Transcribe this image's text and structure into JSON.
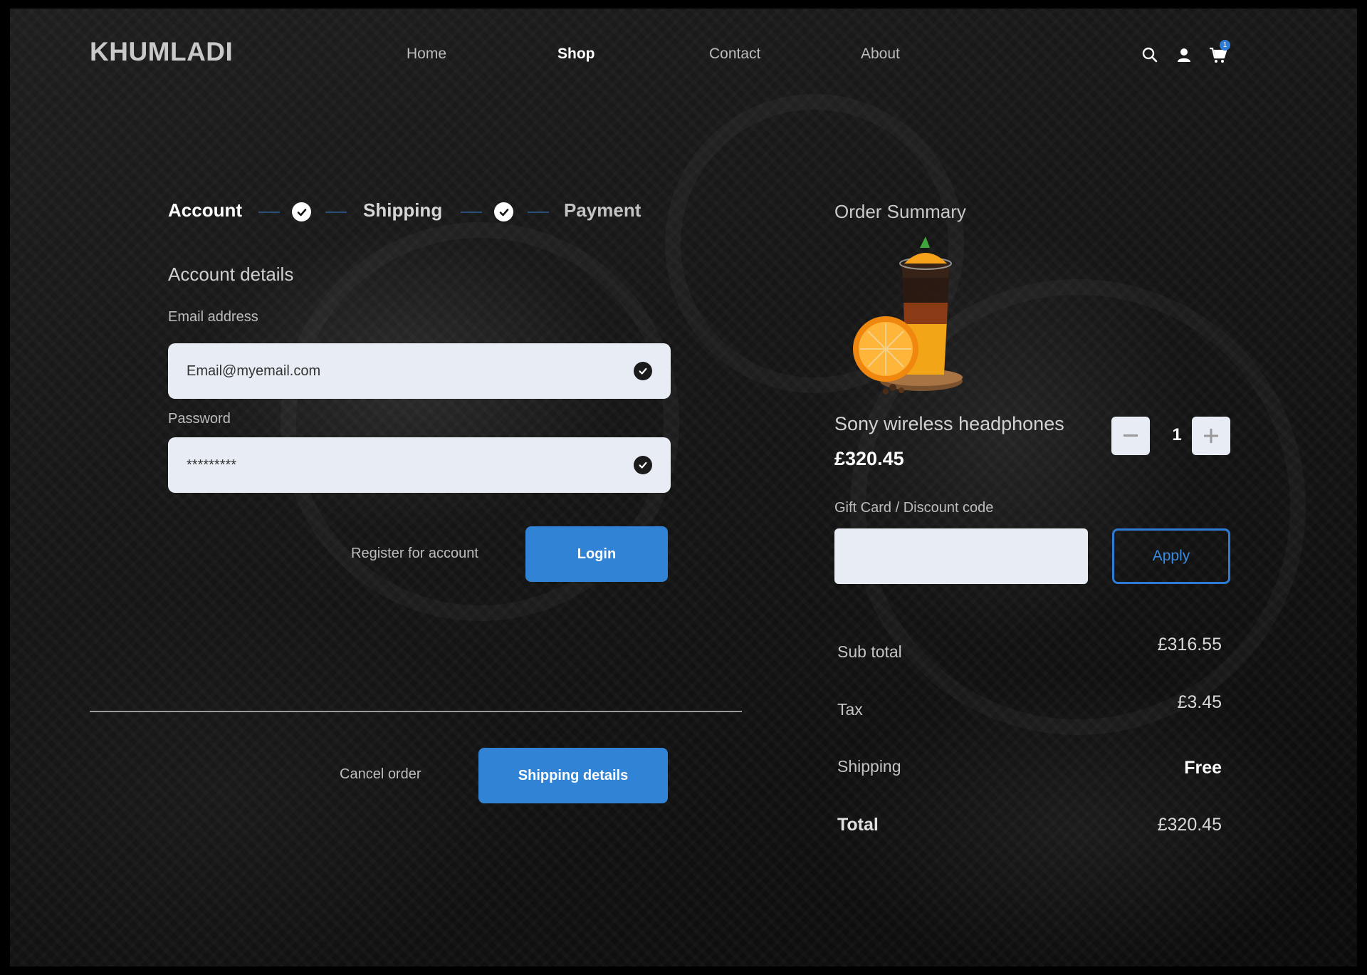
{
  "brand": {
    "name": "KHUMLADI"
  },
  "nav": [
    {
      "label": "Home",
      "active": false
    },
    {
      "label": "Shop",
      "active": true
    },
    {
      "label": "Contact",
      "active": false
    },
    {
      "label": "About",
      "active": false
    }
  ],
  "header_icons": {
    "search": "search-icon",
    "account": "user-icon",
    "cart": "cart-icon",
    "cart_count": "1"
  },
  "stepper": {
    "steps": [
      {
        "label": "Account",
        "state": "done"
      },
      {
        "label": "Shipping",
        "state": "done"
      },
      {
        "label": "Payment",
        "state": "todo"
      }
    ]
  },
  "account": {
    "section_title": "Account details",
    "email_label": "Email address",
    "email_value": "Email@myemail.com",
    "password_label": "Password",
    "password_value": "*********",
    "register_link": "Register for account",
    "login_button": "Login"
  },
  "footer_actions": {
    "cancel": "Cancel order",
    "next": "Shipping details"
  },
  "summary": {
    "title": "Order Summary",
    "product": {
      "name": "Sony wireless headphones",
      "price": "£320.45",
      "quantity": "1"
    },
    "discount_label": "Gift Card / Discount code",
    "discount_value": "",
    "apply_button": "Apply",
    "rows": [
      {
        "label": "Sub total",
        "value": "£316.55"
      },
      {
        "label": "Tax",
        "value": "£3.45"
      },
      {
        "label": "Shipping",
        "value": "Free"
      },
      {
        "label": "Total",
        "value": "£320.45"
      }
    ]
  },
  "colors": {
    "accent": "#3183d6",
    "input_bg": "#e8edf5",
    "background": "#141414"
  }
}
